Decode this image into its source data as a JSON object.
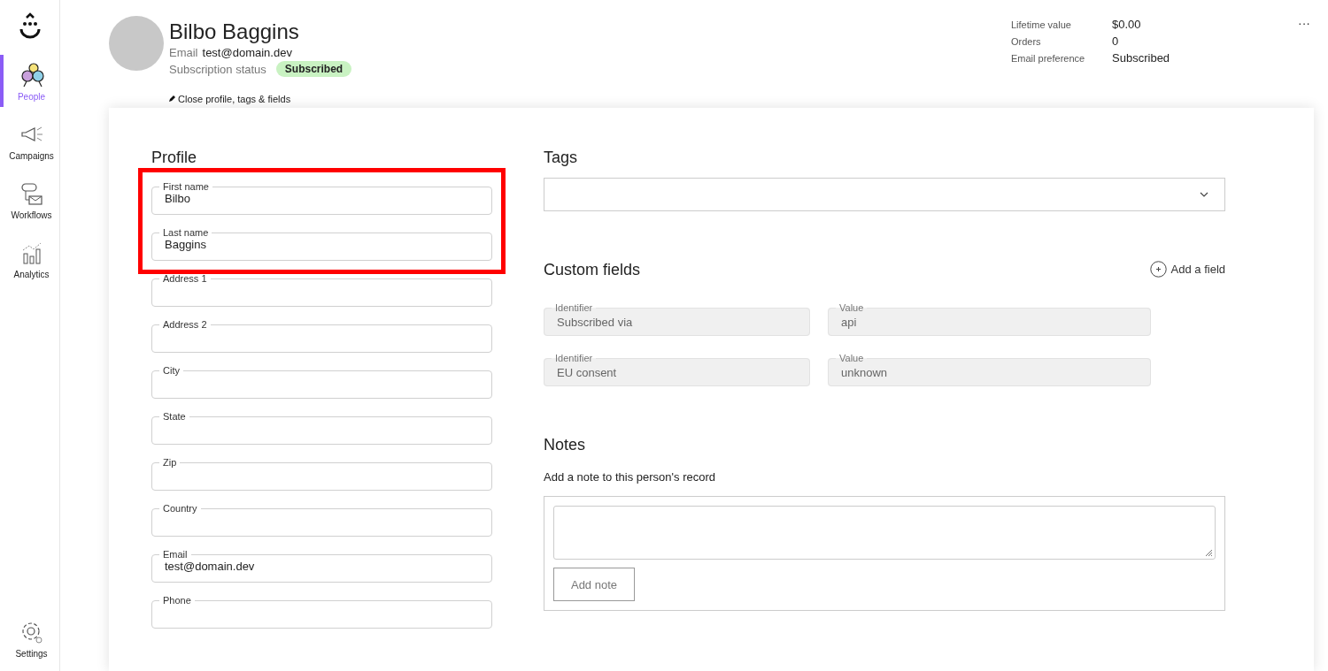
{
  "sidebar": {
    "items": [
      {
        "label": "People",
        "selected": true
      },
      {
        "label": "Campaigns",
        "selected": false
      },
      {
        "label": "Workflows",
        "selected": false
      },
      {
        "label": "Analytics",
        "selected": false
      }
    ],
    "bottom_items": [
      {
        "label": "Settings",
        "selected": false
      }
    ]
  },
  "header": {
    "name": "Bilbo Baggins",
    "email_label": "Email",
    "email": "test@domain.dev",
    "status_label": "Subscription status",
    "status_badge": "Subscribed",
    "stats": [
      {
        "label": "Lifetime value",
        "value": "$0.00"
      },
      {
        "label": "Orders",
        "value": "0"
      },
      {
        "label": "Email preference",
        "value": "Subscribed"
      }
    ],
    "menu": "···",
    "close_link": "Close profile, tags & fields"
  },
  "profile": {
    "title": "Profile",
    "fields": [
      {
        "label": "First name",
        "value": "Bilbo",
        "highlighted": true
      },
      {
        "label": "Last name",
        "value": "Baggins",
        "highlighted": true
      },
      {
        "label": "Address 1",
        "highlighted": false
      },
      {
        "label": "Address 2",
        "highlighted": false
      },
      {
        "label": "City",
        "highlighted": false
      },
      {
        "label": "State",
        "highlighted": false
      },
      {
        "label": "Zip",
        "highlighted": false
      },
      {
        "label": "Country",
        "highlighted": false
      },
      {
        "label": "Email",
        "value": "test@domain.dev",
        "highlighted": false
      },
      {
        "label": "Phone",
        "highlighted": false
      }
    ]
  },
  "tags": {
    "title": "Tags"
  },
  "custom_fields": {
    "title": "Custom fields",
    "add_button": "Add a field",
    "rows": [
      {
        "identifier_label": "Identifier",
        "identifier": "Subscribed via",
        "value_label": "Value",
        "value": "api",
        "disabled": true
      },
      {
        "identifier_label": "Identifier",
        "identifier": "EU consent",
        "value_label": "Value",
        "value": "unknown",
        "disabled": true
      }
    ]
  },
  "notes": {
    "title": "Notes",
    "hint": "Add a note to this person's record",
    "button": "Add note"
  }
}
